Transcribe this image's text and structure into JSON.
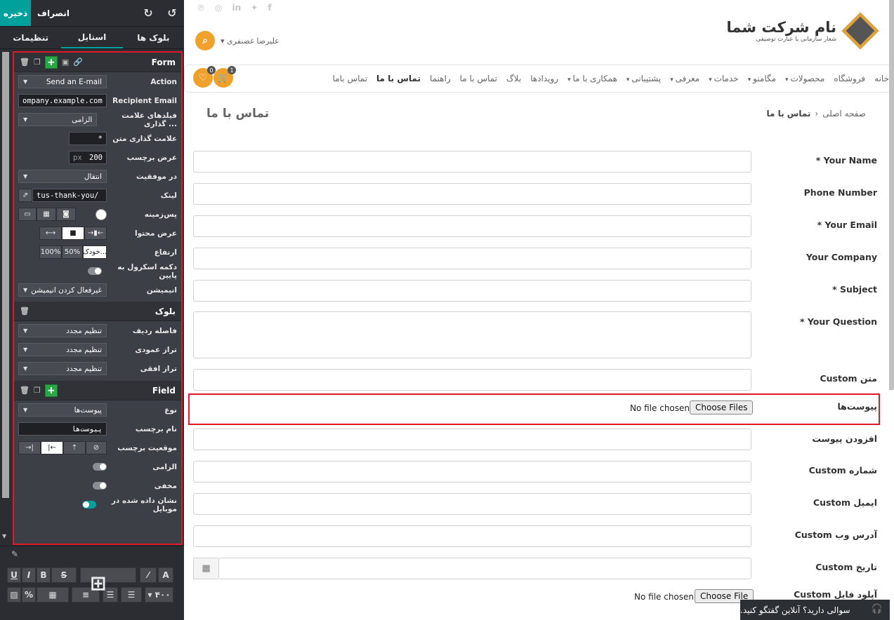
{
  "editor": {
    "save_label": "ذخیره",
    "discard_label": "انصراف",
    "undo_icon": "undo-icon",
    "redo_icon": "redo-icon",
    "tabs": [
      "بلوک ها",
      "استایل",
      "تنظیمات"
    ],
    "form": {
      "title": "Form",
      "rows": {
        "action_label": "Action",
        "action_value": "Send an E-mail",
        "recipient_label": "Recipient Email",
        "recipient_value": "ompany.example.com",
        "marked_fields_label": "فیلدهای علامت گذاری ...",
        "marked_fields_value": "الزامی",
        "mark_text_label": "علامت گذاری متن",
        "mark_text_value": "*",
        "label_width_label": "عرض برچسب",
        "label_width_unit": "px",
        "label_width_value": "200",
        "on_success_label": "در موفقیت",
        "on_success_value": "انتقال",
        "link_label": "لینک",
        "link_value": "tus-thank-you/",
        "background_label": "پس‌زمینه",
        "content_width_label": "عرض محتوا",
        "height_label": "ارتفاع",
        "height_options": [
          "100%",
          "50%",
          "خودک..."
        ],
        "scroll_button_label": "دکمه اسکرول به پایین",
        "animation_label": "انیمیشن",
        "animation_value": "غیرفعال کردن انیمیشن"
      }
    },
    "block": {
      "title": "بلوک",
      "row_spacing_label": "فاصله ردیف",
      "row_spacing_value": "تنظیم مجدد",
      "vertical_align_label": "تراز عمودی",
      "vertical_align_value": "تنظیم مجدد",
      "horizontal_align_label": "تراز افقی",
      "horizontal_align_value": "تنظیم مجدد"
    },
    "field": {
      "title": "Field",
      "type_label": "نوع",
      "type_value": "پیوست‌ها",
      "label_name_label": "نام برچسب",
      "label_name_value": "پیوست‌ها",
      "label_position_label": "موقعیت برچسب",
      "required_label": "الزامی",
      "hidden_label": "مخفی",
      "shown_mobile_label": "نشان داده شده در موبایل"
    },
    "toolbar": {
      "font_size_value": "۴۰۰"
    }
  },
  "site": {
    "social_icons": [
      "pinterest-icon",
      "instagram-icon",
      "linkedin-icon",
      "twitter-icon",
      "facebook-icon"
    ],
    "user_name": "علیرضا غضنفری",
    "logo_title": "نام شرکت شما",
    "logo_tagline": "شعار سازمانی یا عبارت توصیفی",
    "nav": [
      {
        "label": "خانه",
        "dropdown": false
      },
      {
        "label": "فروشگاه",
        "dropdown": false
      },
      {
        "label": "محصولات",
        "dropdown": true
      },
      {
        "label": "مگامنو",
        "dropdown": true
      },
      {
        "label": "خدمات",
        "dropdown": true
      },
      {
        "label": "معرفی",
        "dropdown": true
      },
      {
        "label": "پشتیبانی",
        "dropdown": true
      },
      {
        "label": "همکاری با ما",
        "dropdown": true
      },
      {
        "label": "رویدادها",
        "dropdown": false
      },
      {
        "label": "بلاگ",
        "dropdown": false
      },
      {
        "label": "تماس با ما",
        "dropdown": false
      },
      {
        "label": "راهنما",
        "dropdown": false
      },
      {
        "label": "تماس با ما",
        "dropdown": false,
        "active": true
      },
      {
        "label": "تماس باما",
        "dropdown": false
      }
    ],
    "cart_count": "1",
    "wishlist_count": "0",
    "page_title": "تماس با ما",
    "breadcrumb_home": "صفحه اصلی",
    "breadcrumb_current": "تماس با ما",
    "form_fields": [
      "* Your Name",
      "Phone Number",
      "* Your Email",
      "Your Company",
      "* Subject",
      "* Your Question",
      "Custom متن",
      "پیوست‌ها",
      "افزودن پیوست",
      "Custom شماره",
      "Custom ایمیل",
      "Custom آدرس وب",
      "Custom تاریخ",
      "Custom آپلود فایل"
    ],
    "choose_files_label": "Choose Files",
    "choose_file_label": "Choose File",
    "no_file_label": "No file chosen",
    "chat_label": "سوالی دارید؟ آنلاین گفتگو کنید."
  }
}
